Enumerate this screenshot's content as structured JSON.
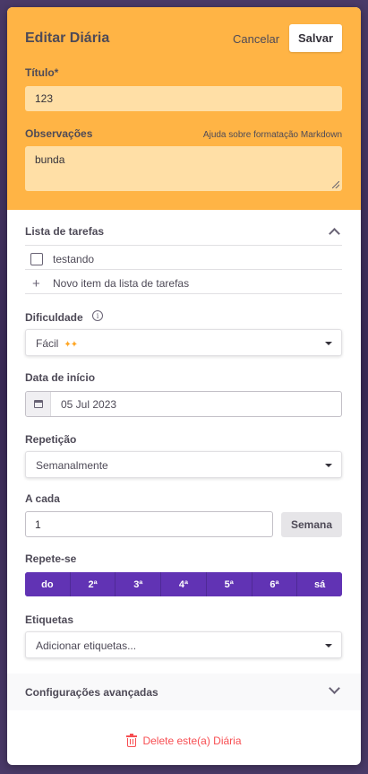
{
  "header": {
    "title": "Editar Diária",
    "cancel_label": "Cancelar",
    "save_label": "Salvar"
  },
  "form": {
    "title_label": "Título*",
    "title_value": "123",
    "notes_label": "Observações",
    "notes_help": "Ajuda sobre formatação Markdown",
    "notes_value": "bunda"
  },
  "checklist": {
    "label": "Lista de tarefas",
    "items": [
      {
        "label": "testando",
        "checked": false
      }
    ],
    "new_item_placeholder": "Novo item da lista de tarefas"
  },
  "difficulty": {
    "label": "Dificuldade",
    "value": "Fácil",
    "stars_glyph": "✦✦"
  },
  "start_date": {
    "label": "Data de início",
    "value": "05 Jul 2023"
  },
  "repeat": {
    "label": "Repetição",
    "value": "Semanalmente"
  },
  "every": {
    "label": "A cada",
    "value": "1",
    "unit": "Semana"
  },
  "repeats_on": {
    "label": "Repete-se",
    "days": [
      "do",
      "2ª",
      "3ª",
      "4ª",
      "5ª",
      "6ª",
      "sá"
    ]
  },
  "tags": {
    "label": "Etiquetas",
    "placeholder": "Adicionar etiquetas..."
  },
  "advanced": {
    "label": "Configurações avançadas"
  },
  "delete": {
    "label": "Delete este(a) Diária"
  },
  "colors": {
    "header_bg": "#ffb445",
    "input_bg": "#ffdfa6",
    "day_active": "#6133b4",
    "danger": "#f74e52"
  }
}
